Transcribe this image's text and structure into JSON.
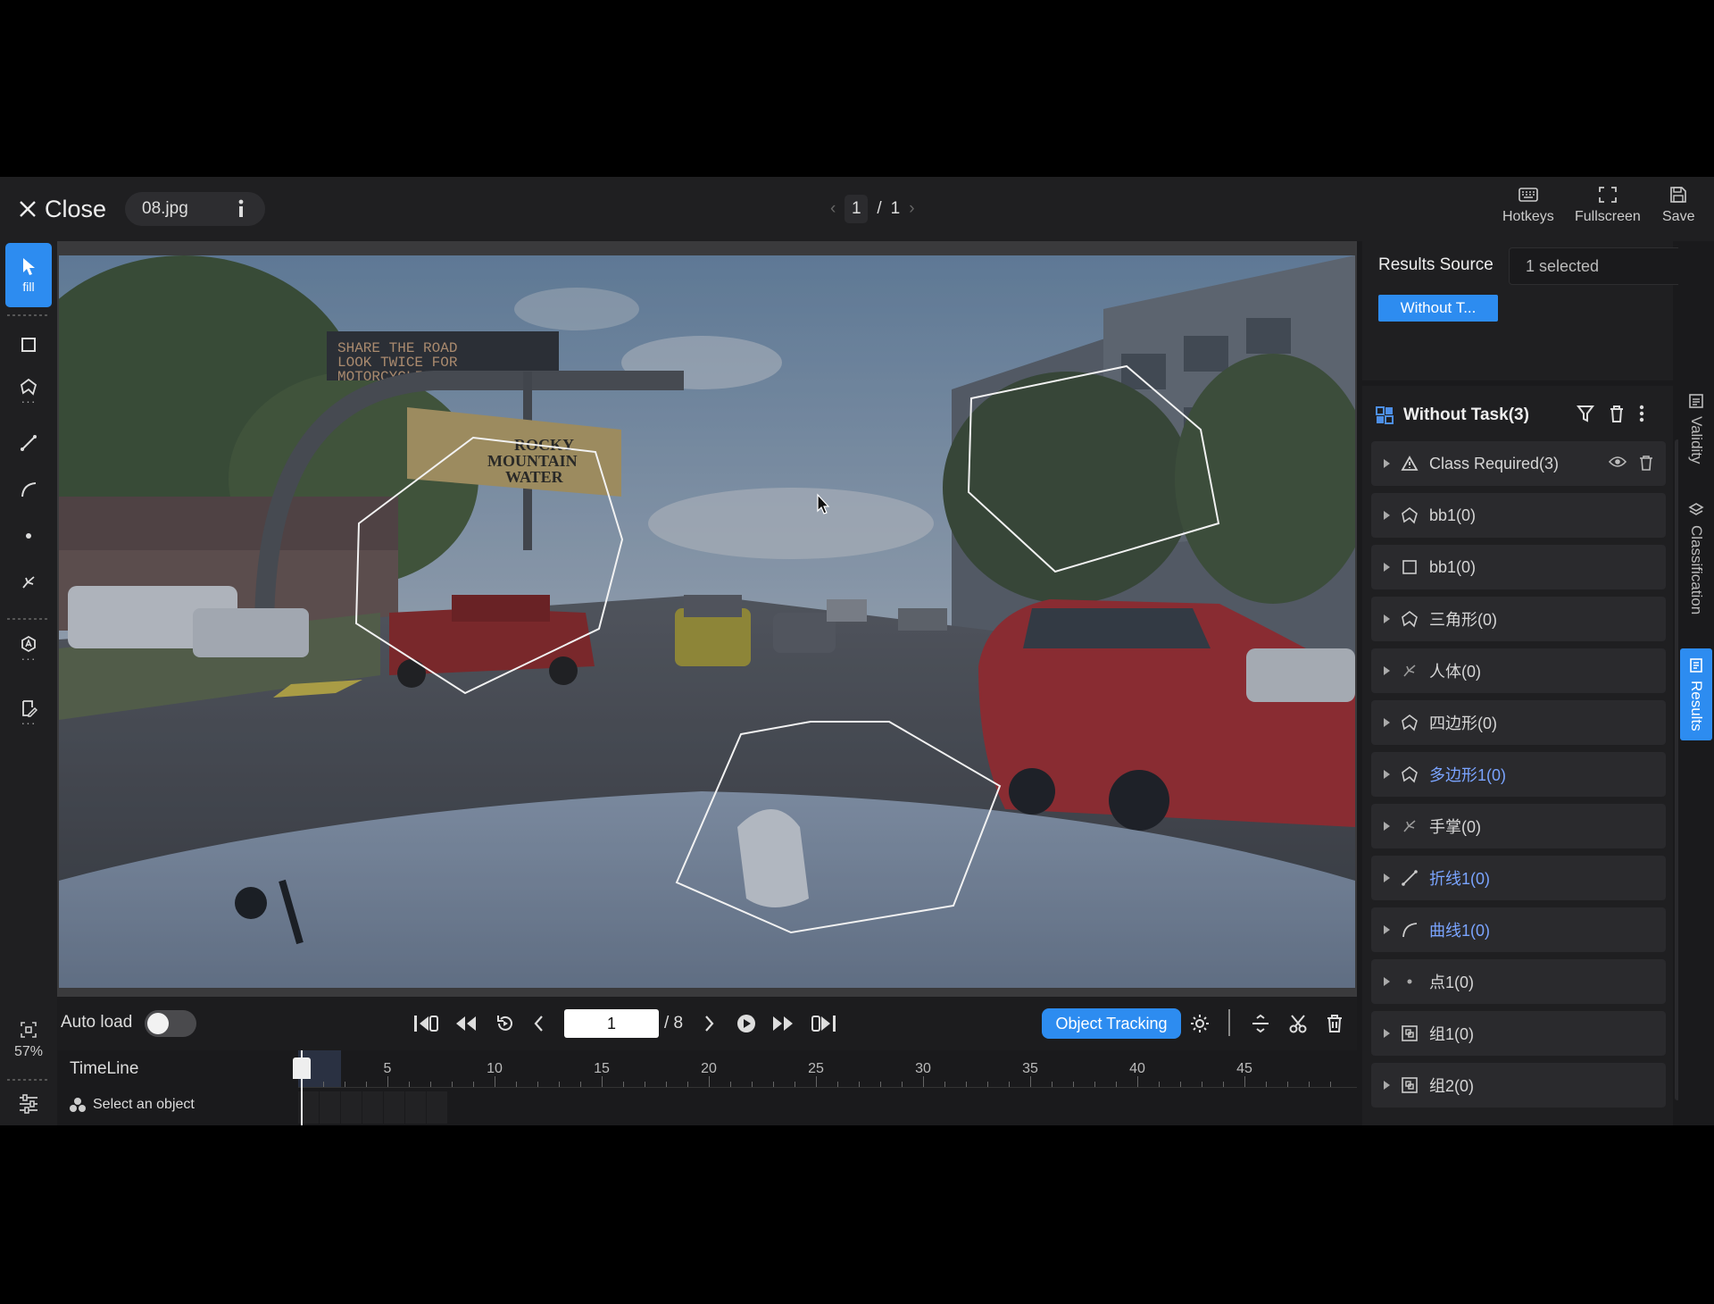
{
  "header": {
    "close_label": "Close",
    "filename": "08.jpg",
    "pager": {
      "current": "1",
      "separator": "/",
      "total": "1"
    },
    "buttons": {
      "hotkeys": "Hotkeys",
      "fullscreen": "Fullscreen",
      "save": "Save"
    }
  },
  "toolbar": {
    "active_tool_label": "fill",
    "zoom": "57%",
    "tools": [
      "select-tool",
      "rectangle-tool",
      "polygon-tool",
      "polyline-tool",
      "curve-tool",
      "point-tool",
      "skeleton-tool",
      "auto-segment-tool",
      "annotation-tool"
    ]
  },
  "scene_text": {
    "sign_line1": "SHARE THE ROAD",
    "sign_line2": "LOOK TWICE FOR",
    "sign_line3": "MOTORCYCLISTS",
    "billboard_line1": "ROCKY",
    "billboard_line2": "MOUNTAIN",
    "billboard_line3": "WATER"
  },
  "controls": {
    "autoload_label": "Auto load",
    "autoload_on": false,
    "frame_value": "1",
    "frame_total": "/ 8",
    "object_tracking_label": "Object Tracking"
  },
  "timeline": {
    "label": "TimeLine",
    "select_hint": "Select an object",
    "tick_labels": [
      "5",
      "10",
      "15",
      "20",
      "25",
      "30",
      "35",
      "40",
      "45"
    ],
    "current_frame": 1
  },
  "results_source": {
    "label": "Results Source",
    "selected_text": "1 selected",
    "tag": "Without T..."
  },
  "task_panel": {
    "title": "Without Task(3)",
    "items": [
      {
        "name": "Class Required(3)",
        "icon": "warning-icon"
      },
      {
        "name": "bb1(0)",
        "icon": "polygon-icon"
      },
      {
        "name": "bb1(0)",
        "icon": "rectangle-icon"
      },
      {
        "name": "三角形(0)",
        "icon": "polygon-icon"
      },
      {
        "name": "人体(0)",
        "icon": "skeleton-icon"
      },
      {
        "name": "四边形(0)",
        "icon": "polygon-icon"
      },
      {
        "name": "多边形1(0)",
        "icon": "polygon-icon"
      },
      {
        "name": "手掌(0)",
        "icon": "skeleton-icon"
      },
      {
        "name": "折线1(0)",
        "icon": "polyline-icon"
      },
      {
        "name": "曲线1(0)",
        "icon": "curve-icon"
      },
      {
        "name": "点1(0)",
        "icon": "point-icon"
      },
      {
        "name": "组1(0)",
        "icon": "group-icon"
      },
      {
        "name": "组2(0)",
        "icon": "group-icon"
      }
    ]
  },
  "side_tabs": {
    "validity": "Validity",
    "classification": "Classification",
    "results": "Results"
  },
  "colors": {
    "accent": "#2d8cf0",
    "panel": "#1f1f21",
    "item": "#2a2a2d",
    "link_blue": "#7aa4ff"
  }
}
